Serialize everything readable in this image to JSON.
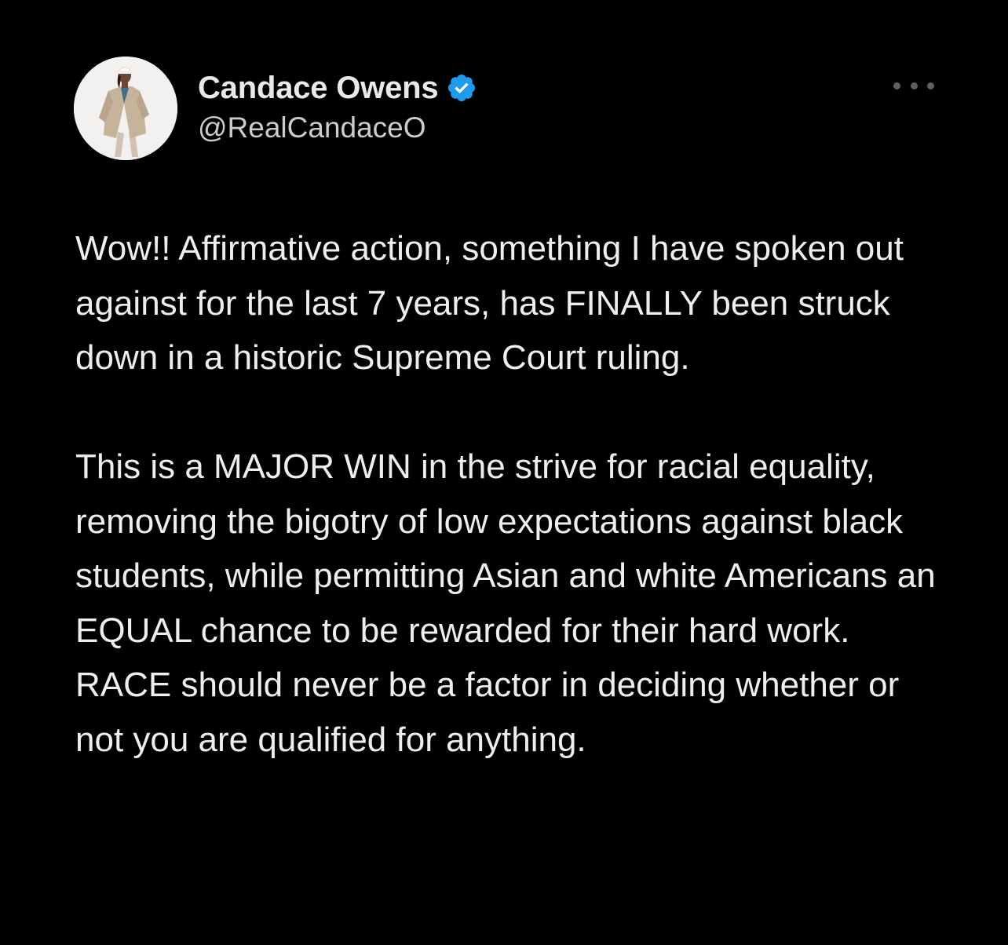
{
  "author": {
    "display_name": "Candace Owens",
    "handle": "@RealCandaceO",
    "verified": true,
    "verified_color": "#1d9bf0"
  },
  "menu": {
    "icon": "more-options-icon"
  },
  "tweet": {
    "paragraphs": [
      "Wow!! Affirmative action, something I have spoken out against for the last 7 years, has FINALLY been struck down in a historic Supreme Court ruling.",
      "This is a MAJOR WIN in the strive for racial equality, removing the bigotry of low expectations against black students, while permitting Asian and white Americans an EQUAL chance to be rewarded for their hard work. RACE should never be a factor in deciding whether or not you are qualified for anything."
    ]
  },
  "theme": {
    "background": "#000000",
    "text": "#e7e9ea",
    "secondary_text": "#c9ccd0"
  }
}
